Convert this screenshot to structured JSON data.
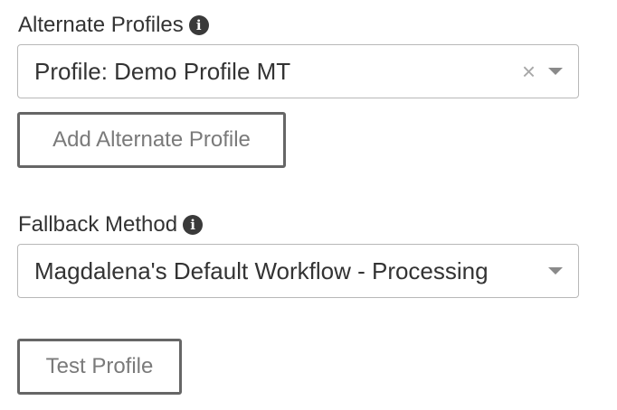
{
  "alternate_profiles": {
    "label": "Alternate Profiles",
    "info_icon": "i",
    "selected_value": "Profile: Demo Profile MT",
    "clear_icon": "×",
    "add_button_label": "Add Alternate Profile"
  },
  "fallback_method": {
    "label": "Fallback Method",
    "info_icon": "i",
    "selected_value": "Magdalena's Default Workflow - Processing"
  },
  "test_button_label": "Test Profile"
}
